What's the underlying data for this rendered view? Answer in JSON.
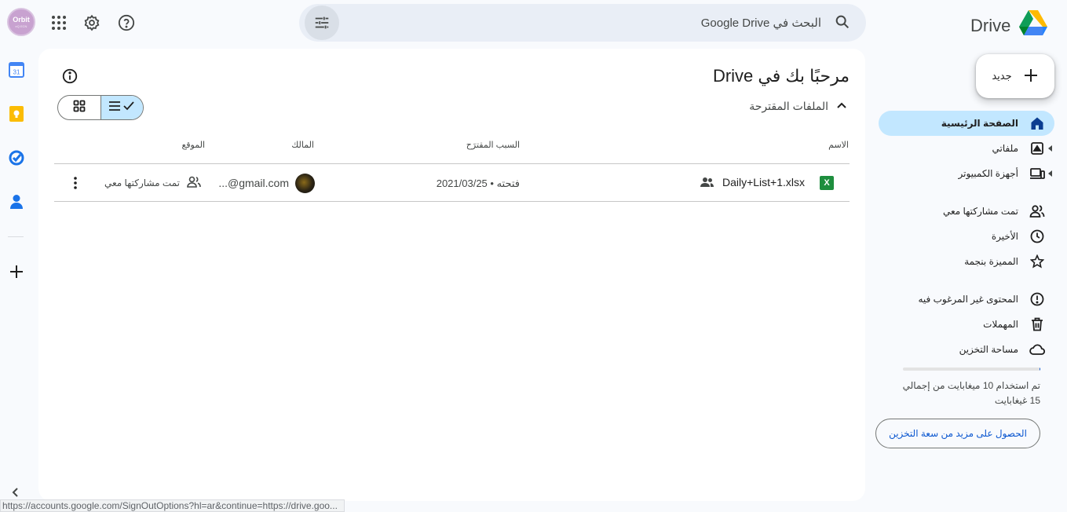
{
  "account": {
    "avatar_text": "Orbit",
    "avatar_subtext": "eQ ECN"
  },
  "search": {
    "placeholder": "البحث في Google Drive"
  },
  "brand": {
    "name": "Drive"
  },
  "main": {
    "title": "مرحبًا بك في Drive",
    "section_title": "الملفات المقترحة",
    "columns": {
      "name": "الاسم",
      "reason": "السبب المقترَح",
      "owner": "المالك",
      "location": "الموقع"
    },
    "rows": [
      {
        "name": "Daily+List+1.xlsx",
        "file_icon": "X",
        "reason": "فتحته • 2021/03/25",
        "owner": "...@gmail.com",
        "location": "تمت مشاركتها معي"
      }
    ]
  },
  "sidebar": {
    "new_label": "جديد",
    "items": [
      {
        "label": "الصفحة الرئيسية",
        "icon": "home-icon"
      },
      {
        "label": "ملفاتي",
        "icon": "my-drive-icon"
      },
      {
        "label": "أجهزة الكمبيوتر",
        "icon": "computers-icon"
      },
      {
        "label": "تمت مشاركتها معي",
        "icon": "shared-icon"
      },
      {
        "label": "الأخيرة",
        "icon": "clock-icon"
      },
      {
        "label": "المميزة بنجمة",
        "icon": "star-icon"
      },
      {
        "label": "المحتوى غير المرغوب فيه",
        "icon": "spam-icon"
      },
      {
        "label": "المهملات",
        "icon": "trash-icon"
      },
      {
        "label": "مساحة التخزين",
        "icon": "cloud-icon"
      }
    ],
    "storage_text": "تم استخدام 10 ميغابايت من إجمالي 15 غيغابايت",
    "storage_fraction": 0.0007,
    "storage_button": "الحصول على مزيد من سعة التخزين"
  },
  "status_bar": {
    "url": "https://accounts.google.com/SignOutOptions?hl=ar&continue=https://drive.goo..."
  },
  "colors": {
    "accent": "#0b57d0",
    "selected": "#c2e7ff",
    "search_bg": "#e9eef6"
  }
}
